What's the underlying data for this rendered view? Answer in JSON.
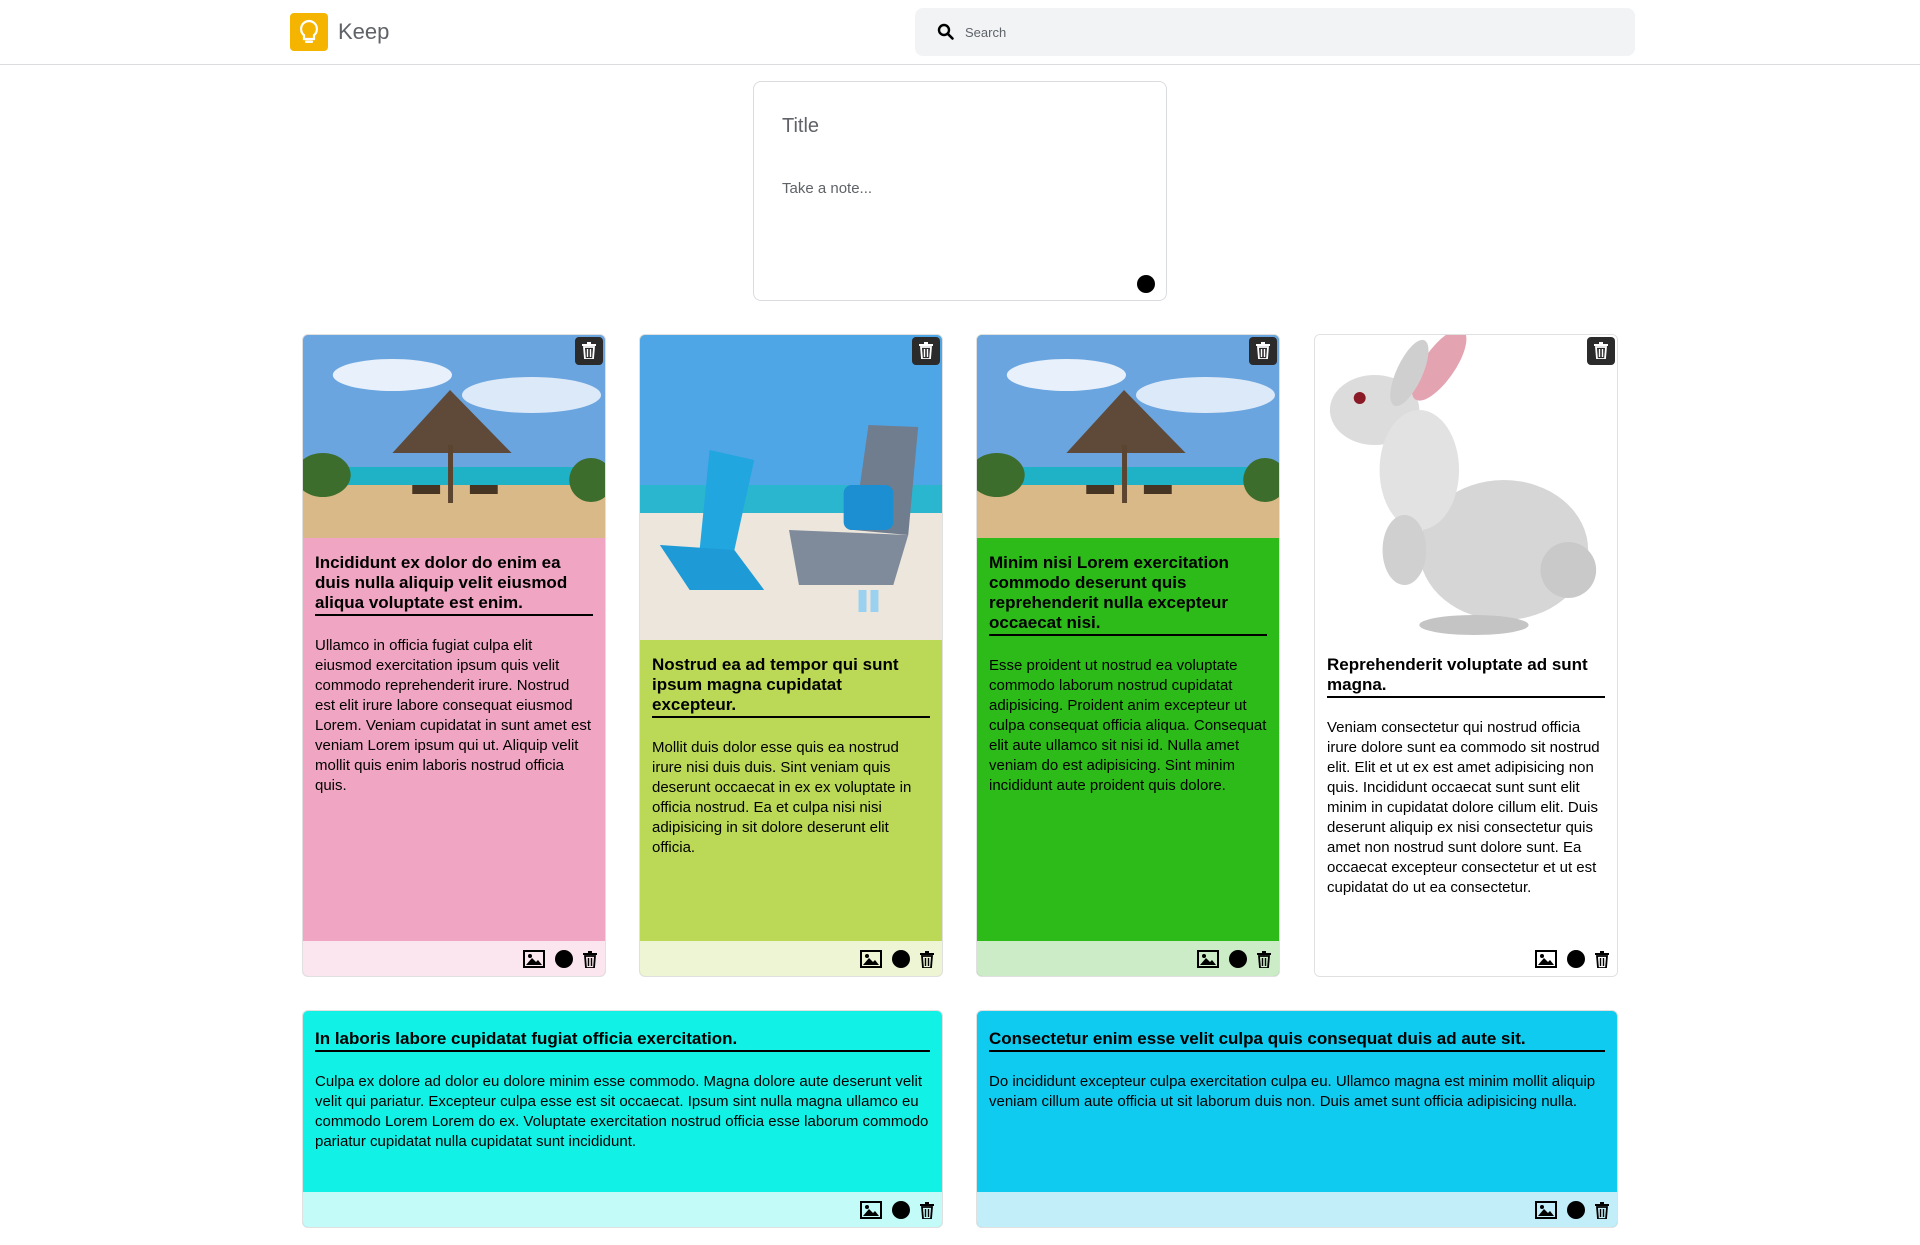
{
  "app": {
    "name": "Keep",
    "logo_icon": "lightbulb-icon",
    "brand_color": "#f5b400"
  },
  "search": {
    "placeholder": "Search",
    "icon": "search-icon"
  },
  "composer": {
    "title_placeholder": "Title",
    "body_placeholder": "Take a note...",
    "color_icon": "color-dot-icon"
  },
  "notes": [
    {
      "title": "Incididunt ex dolor do enim ea duis nulla aliquip velit eiusmod aliqua voluptate est enim.",
      "body": "Ullamco in officia fugiat culpa elit eiusmod exercitation ipsum quis velit commodo reprehenderit irure. Nostrud est elit irure labore consequat eiusmod Lorem. Veniam cupidatat in sunt amet est veniam Lorem ipsum qui ut. Aliquip velit mollit quis enim laboris nostrud officia quis.",
      "color": "#f0a6c2",
      "footer_color": "#fbe5ee",
      "image": "beach-umbrella"
    },
    {
      "title": "Nostrud ea ad tempor qui sunt ipsum magna cupidatat excepteur.",
      "body": "Mollit duis dolor esse quis ea nostrud irure nisi duis duis. Sint veniam quis deserunt occaecat in ex ex voluptate in officia nostrud. Ea et culpa nisi nisi adipisicing in sit dolore deserunt elit officia.",
      "color": "#bbd957",
      "footer_color": "#eef5d4",
      "image": "beach-chairs"
    },
    {
      "title": "Minim nisi Lorem exercitation commodo deserunt quis reprehenderit nulla excepteur occaecat nisi.",
      "body": "Esse proident ut nostrud ea voluptate commodo laborum nostrud cupidatat adipisicing. Proident anim excepteur ut culpa consequat officia aliqua. Consequat elit aute ullamco sit nisi id. Nulla amet veniam do est adipisicing. Sint minim incididunt aute proident quis dolore.",
      "color": "#2dbb1a",
      "footer_color": "#cbecc6",
      "image": "beach-umbrella"
    },
    {
      "title": "Reprehenderit voluptate ad sunt magna.",
      "body": "Veniam consectetur qui nostrud officia irure dolore sunt ea commodo sit nostrud elit. Elit et ut ex est amet adipisicing non quis. Incididunt occaecat sunt sunt elit minim in cupidatat dolore cillum elit. Duis deserunt aliquip ex nisi consectetur quis amet non nostrud sunt dolore sunt. Ea occaecat excepteur consectetur et ut est cupidatat do ut ea consectetur.",
      "color": "#ffffff",
      "footer_color": "#ffffff",
      "image": "rabbit"
    },
    {
      "title": "In laboris labore cupidatat fugiat officia exercitation.",
      "body": "Culpa ex dolore ad dolor eu dolore minim esse commodo. Magna dolore aute deserunt velit velit qui pariatur. Excepteur culpa esse est sit occaecat. Ipsum sint nulla magna ullamco eu commodo Lorem Lorem do ex. Voluptate exercitation nostrud officia esse laborum commodo pariatur cupidatat nulla cupidatat sunt incididunt.",
      "color": "#12f1e6",
      "footer_color": "#c2fbf8"
    },
    {
      "title": "Consectetur enim esse velit culpa quis consequat duis ad aute sit.",
      "body": "Do incididunt excepteur culpa exercitation culpa eu. Ullamco magna est minim mollit aliquip veniam cillum aute officia ut sit laborum duis non. Duis amet sunt officia adipisicing nulla.",
      "color": "#0fcbef",
      "footer_color": "#c2eef9"
    }
  ],
  "note_tools": [
    "image-icon",
    "color-dot-icon",
    "trash-icon"
  ]
}
